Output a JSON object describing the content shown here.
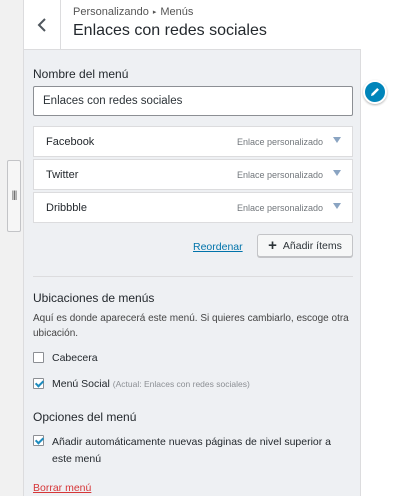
{
  "header": {
    "breadcrumb_parent": "Personalizando",
    "breadcrumb_child": "Menús",
    "title": "Enlaces con redes sociales"
  },
  "menu_name": {
    "label": "Nombre del menú",
    "value": "Enlaces con redes sociales"
  },
  "menu_items": [
    {
      "title": "Facebook",
      "type": "Enlace personalizado"
    },
    {
      "title": "Twitter",
      "type": "Enlace personalizado"
    },
    {
      "title": "Dribbble",
      "type": "Enlace personalizado"
    }
  ],
  "actions": {
    "reorder": "Reordenar",
    "add_items": "Añadir ítems"
  },
  "locations": {
    "title": "Ubicaciones de menús",
    "description": "Aquí es donde aparecerá este menú. Si quieres cambiarlo, escoge otra ubicación.",
    "items": [
      {
        "label": "Cabecera",
        "checked": false,
        "note": ""
      },
      {
        "label": "Menú Social",
        "checked": true,
        "note": "(Actual: Enlaces con redes sociales)"
      }
    ]
  },
  "options": {
    "title": "Opciones del menú",
    "auto_add_label": "Añadir automáticamente nuevas páginas de nivel superior a este menú",
    "auto_add_checked": true
  },
  "delete_label": "Borrar menú",
  "colors": {
    "panel_bg": "#eef0f3",
    "accent": "#0085ba",
    "link": "#0073aa",
    "danger": "#d63638"
  }
}
